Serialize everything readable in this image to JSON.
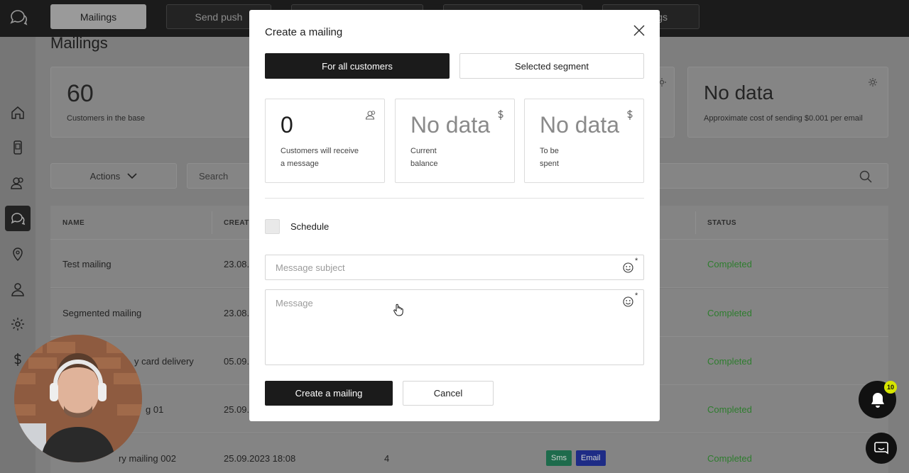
{
  "topbar": {
    "tabs": [
      {
        "label": "Mailings",
        "active": true
      },
      {
        "label": "Send push",
        "active": false
      },
      {
        "label": "",
        "active": false
      },
      {
        "label": "",
        "active": false
      },
      {
        "label": "gs",
        "active": false
      }
    ]
  },
  "sidebar": {
    "icons": [
      "home-icon",
      "phone-icon",
      "users-icon",
      "chat-icon",
      "location-icon",
      "user-icon",
      "gear-icon",
      "dollar-icon"
    ],
    "active": "chat-icon"
  },
  "page": {
    "title": "Mailings",
    "card1": {
      "value": "60",
      "label": "Customers in the base"
    },
    "card2": {
      "value": "No data",
      "label": "Approximate cost of sending $0.001 per email"
    },
    "actions_label": "Actions",
    "search_placeholder": "Search"
  },
  "table": {
    "headers": [
      "NAME",
      "CREATE",
      "STATUS"
    ],
    "rows": [
      {
        "name": "Test mailing",
        "date": "23.08.",
        "count": "",
        "status": "Completed",
        "tags": []
      },
      {
        "name": "Segmented mailing",
        "date": "23.08.",
        "count": "",
        "status": "Completed",
        "tags": []
      },
      {
        "name": "y card delivery",
        "date": "05.09.",
        "count": "",
        "status": "Completed",
        "tags": []
      },
      {
        "name": "g 01",
        "date": "25.09.",
        "count": "",
        "status": "Completed",
        "tags": []
      },
      {
        "name": "ry mailing 002",
        "date": "25.09.2023 18:08",
        "count": "4",
        "status": "Completed",
        "tags": [
          "Sms",
          "Email"
        ]
      }
    ]
  },
  "modal": {
    "title": "Create a mailing",
    "segment_all": "For all customers",
    "segment_selected": "Selected segment",
    "stats": [
      {
        "value": "0",
        "desc": "Customers will receive\na message",
        "icon": "users-icon"
      },
      {
        "value": "No data",
        "desc": "Current\nbalance",
        "icon": "dollar-icon"
      },
      {
        "value": "No data",
        "desc": "To be\nspent",
        "icon": "dollar-icon"
      }
    ],
    "schedule_label": "Schedule",
    "subject_placeholder": "Message subject",
    "message_placeholder": "Message",
    "required_mark": "*",
    "create_label": "Create a mailing",
    "cancel_label": "Cancel"
  },
  "notifications": {
    "count": "10"
  },
  "colors": {
    "accent": "#1b1b1b",
    "status_completed": "#2e7d2e",
    "badge": "#d6e500"
  }
}
